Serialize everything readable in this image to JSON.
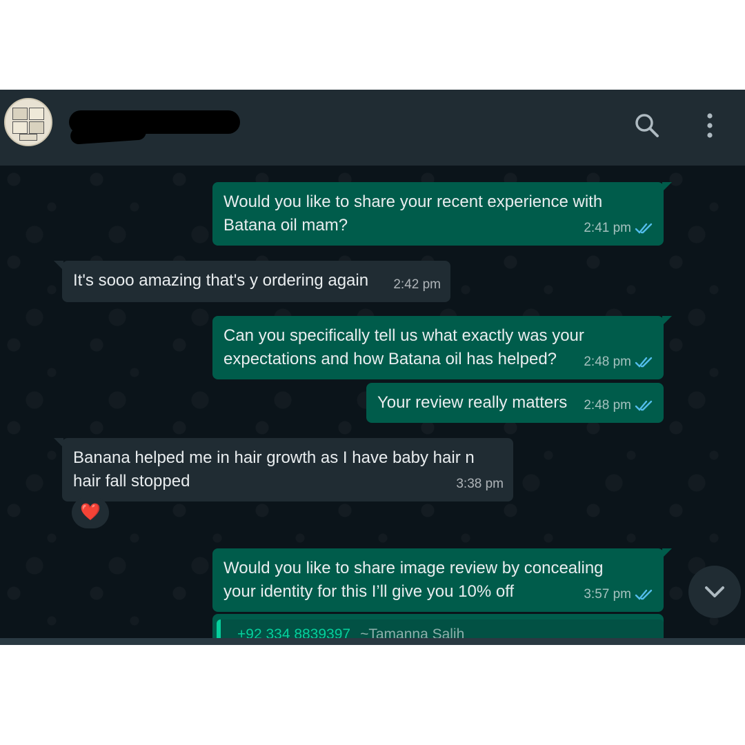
{
  "header": {
    "contact_name": "",
    "search_icon": "search-icon",
    "menu_icon": "more-vertical-icon"
  },
  "colors": {
    "outgoing_bubble": "#005c4b",
    "incoming_bubble": "#202c33",
    "background": "#0b141a",
    "read_receipt": "#53bdeb",
    "quote_accent": "#06cf9c"
  },
  "messages": [
    {
      "direction": "out",
      "text": "Would you like to share your recent experience with\nBatana oil mam?",
      "time": "2:41 pm",
      "status": "read"
    },
    {
      "direction": "in",
      "text": "It's sooo amazing that's y ordering again",
      "time": "2:42 pm"
    },
    {
      "direction": "out",
      "text": "Can you specifically tell us what exactly was your\nexpectations and how Batana oil has helped?",
      "time": "2:48 pm",
      "status": "read"
    },
    {
      "direction": "out",
      "text": "Your review really matters",
      "time": "2:48 pm",
      "status": "read"
    },
    {
      "direction": "in",
      "text": "Banana helped me in hair growth as I have baby hair n\nhair fall stopped",
      "time": "3:38 pm",
      "reaction": "❤️"
    },
    {
      "direction": "out",
      "text": "Would you like to share image review by concealing\nyour identity for this I’ll give you 10% off",
      "time": "3:57 pm",
      "status": "read"
    }
  ],
  "quoted_message": {
    "phone": "+92 334 8839397",
    "author": "~Tamanna Salih"
  },
  "scroll_down_icon": "chevron-down-icon"
}
